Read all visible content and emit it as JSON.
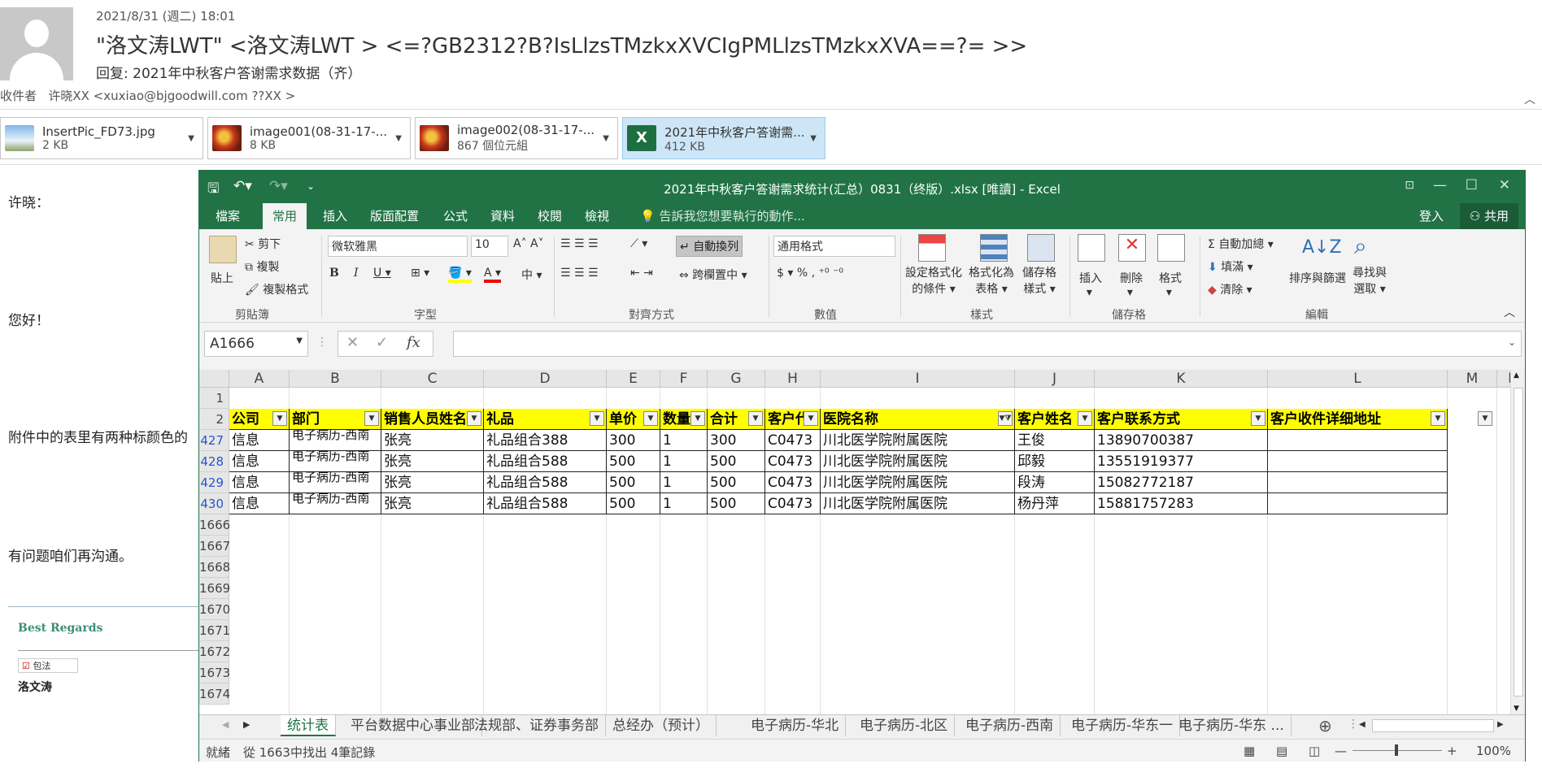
{
  "email": {
    "date": "2021/8/31 (週二) 18:01",
    "from": "\"洛文涛LWT\" <洛文涛LWT > <=?GB2312?B?IsLlzsTMzkxXVCIgPMLlzsTMzkxXVA==?= >>",
    "subject": "回复: 2021年中秋客户答谢需求数据（齐）",
    "to_label": "收件者",
    "to_value": "许晓XX <xuxiao@bjgoodwill.com ??XX >"
  },
  "attachments": [
    {
      "name": "InsertPic_FD73.jpg",
      "size": "2 KB",
      "icon": "image-icon"
    },
    {
      "name": "image001(08-31-17-...",
      "size": "8 KB",
      "icon": "image-icon"
    },
    {
      "name": "image002(08-31-17-...",
      "size": "867 個位元組",
      "icon": "image-icon"
    },
    {
      "name": "2021年中秋客户答谢需...",
      "size": "412 KB",
      "icon": "excel-icon"
    }
  ],
  "body": {
    "greeting": "许晓：",
    "hello": "您好！",
    "line1": "附件中的表里有两种标颜色的",
    "line2": "有问题咱们再沟通。",
    "regards": "Best Regards",
    "badge": "包法",
    "signature": "洛文涛"
  },
  "excel": {
    "title": "2021年中秋客户答谢需求统计(汇总）0831（终版）.xlsx  [唯讀] - Excel",
    "tabs": [
      "檔案",
      "常用",
      "插入",
      "版面配置",
      "公式",
      "資料",
      "校閱",
      "檢視"
    ],
    "tell_me": "告訴我您想要執行的動作...",
    "login": "登入",
    "share": "共用",
    "ribbon": {
      "paste": "貼上",
      "cut": "剪下",
      "copy": "複製",
      "format_painter": "複製格式",
      "clipboard": "剪貼簿",
      "font_name": "微软雅黑",
      "font_size": "10",
      "font_group": "字型",
      "wrap": "自動換列",
      "merge": "跨欄置中",
      "align_group": "對齊方式",
      "number_format": "通用格式",
      "number_group": "數值",
      "cond_format": [
        "設定格式化",
        "的條件"
      ],
      "as_table": [
        "格式化為",
        "表格"
      ],
      "cell_styles": [
        "儲存格",
        "樣式"
      ],
      "styles_group": "樣式",
      "insert": "插入",
      "delete": "刪除",
      "format": "格式",
      "cells_group": "儲存格",
      "autosum": "自動加總",
      "fill": "填滿",
      "clear": "清除",
      "sort": "排序與篩選",
      "find": [
        "尋找與",
        "選取"
      ],
      "edit_group": "編輯"
    },
    "name_box": "A1666",
    "columns": [
      "A",
      "B",
      "C",
      "D",
      "E",
      "F",
      "G",
      "H",
      "I",
      "J",
      "K",
      "L",
      "M",
      "N"
    ],
    "headers": [
      "公司",
      "部门",
      "销售人员姓名",
      "礼品",
      "单价",
      "数量",
      "合计",
      "客户代",
      "医院名称",
      "客户姓名",
      "客户联系方式",
      "客户收件详细地址"
    ],
    "rows": [
      {
        "num": "427",
        "cells": [
          "信息",
          "电子病历-西南",
          "张亮",
          "礼品组合388",
          "300",
          "1",
          "300",
          "C0473",
          "川北医学院附属医院",
          "王俊",
          "13890700387",
          ""
        ]
      },
      {
        "num": "428",
        "cells": [
          "信息",
          "电子病历-西南",
          "张亮",
          "礼品组合588",
          "500",
          "1",
          "500",
          "C0473",
          "川北医学院附属医院",
          "邱毅",
          "13551919377",
          ""
        ]
      },
      {
        "num": "429",
        "cells": [
          "信息",
          "电子病历-西南",
          "张亮",
          "礼品组合588",
          "500",
          "1",
          "500",
          "C0473",
          "川北医学院附属医院",
          "段涛",
          "15082772187",
          ""
        ]
      },
      {
        "num": "430",
        "cells": [
          "信息",
          "电子病历-西南",
          "张亮",
          "礼品组合588",
          "500",
          "1",
          "500",
          "C0473",
          "川北医学院附属医院",
          "杨丹萍",
          "15881757283",
          ""
        ]
      }
    ],
    "empty_rows": [
      "1666",
      "1667",
      "1668",
      "1669",
      "1670",
      "1671",
      "1672",
      "1673",
      "1674"
    ],
    "sheet_tabs": [
      "统计表",
      "平台数据中心事业部",
      "法规部、证券事务部",
      "总经办（预计）",
      "电子病历-华北",
      "电子病历-北区",
      "电子病历-西南",
      "电子病历-华东一",
      "电子病历-华东 ..."
    ],
    "status_ready": "就緒",
    "status_filter": "從 1663中找出 4筆記錄",
    "zoom": "100%"
  }
}
